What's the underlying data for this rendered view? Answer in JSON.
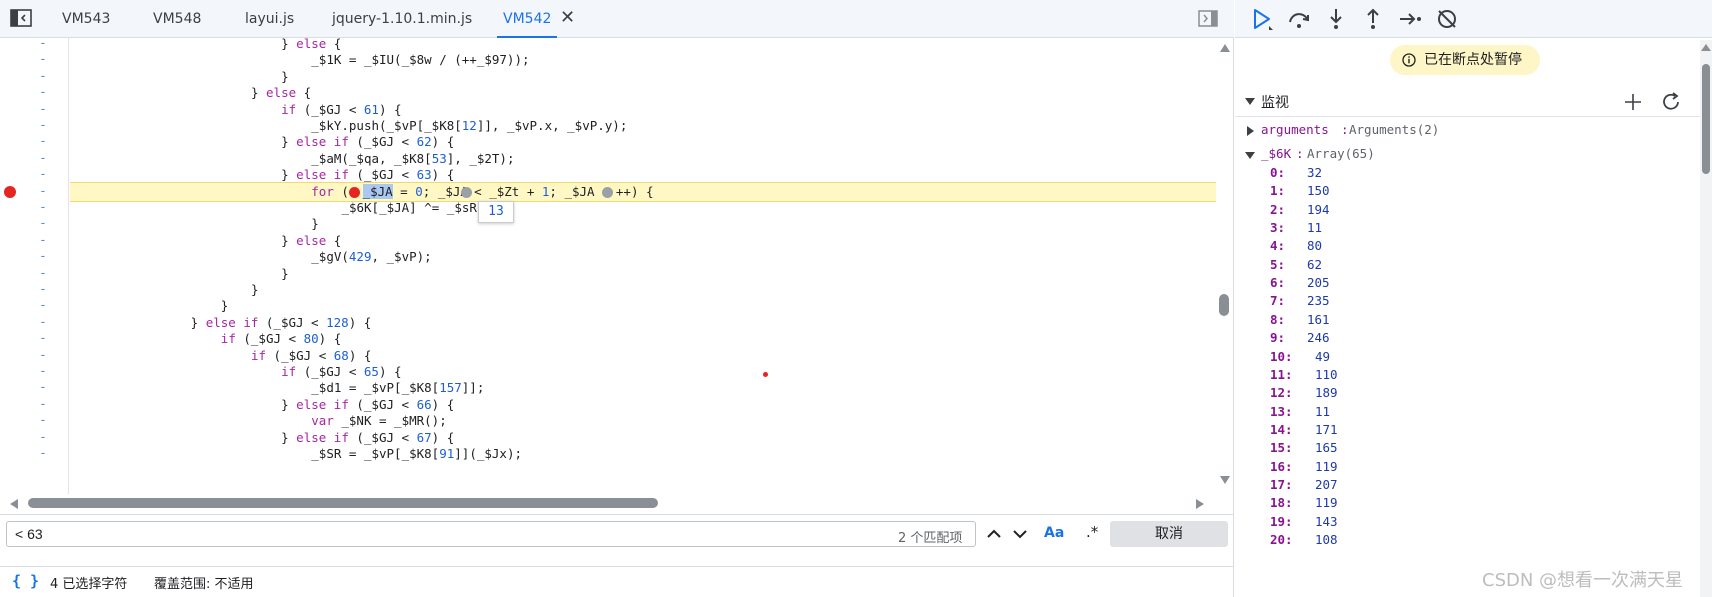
{
  "tabs": [
    {
      "label": "VM543",
      "active": false
    },
    {
      "label": "VM548",
      "active": false
    },
    {
      "label": "layui.js",
      "active": false
    },
    {
      "label": "jquery-1.10.1.min.js",
      "active": false
    },
    {
      "label": "VM542",
      "active": true
    }
  ],
  "tooltip_value": "13",
  "search": {
    "query": "< 63",
    "match_count": "2 个匹配项",
    "case_label": "Aa",
    "regex_label": ".*",
    "cancel_label": "取消"
  },
  "status": {
    "pretty_print": "{ }",
    "selection": "4 已选择字符",
    "coverage": "覆盖范围: 不适用"
  },
  "debugger": {
    "paused_text": "已在断点处暂停",
    "watch_title": "监视",
    "arguments_name": "arguments",
    "arguments_value": "Arguments(2)",
    "array_name": "_$6K",
    "array_value": "Array(65)",
    "array_items": [
      32,
      150,
      194,
      11,
      80,
      62,
      205,
      235,
      161,
      246,
      49,
      110,
      189,
      11,
      171,
      165,
      119,
      207,
      119,
      143,
      108
    ]
  },
  "watermark": "CSDN @想看一次满天星",
  "colors": {
    "accent": "#1a73e8",
    "breakpoint": "#e52521",
    "paused_line": "#fff8c4",
    "keyword": "#a626a4",
    "number": "#1c5fd6"
  }
}
